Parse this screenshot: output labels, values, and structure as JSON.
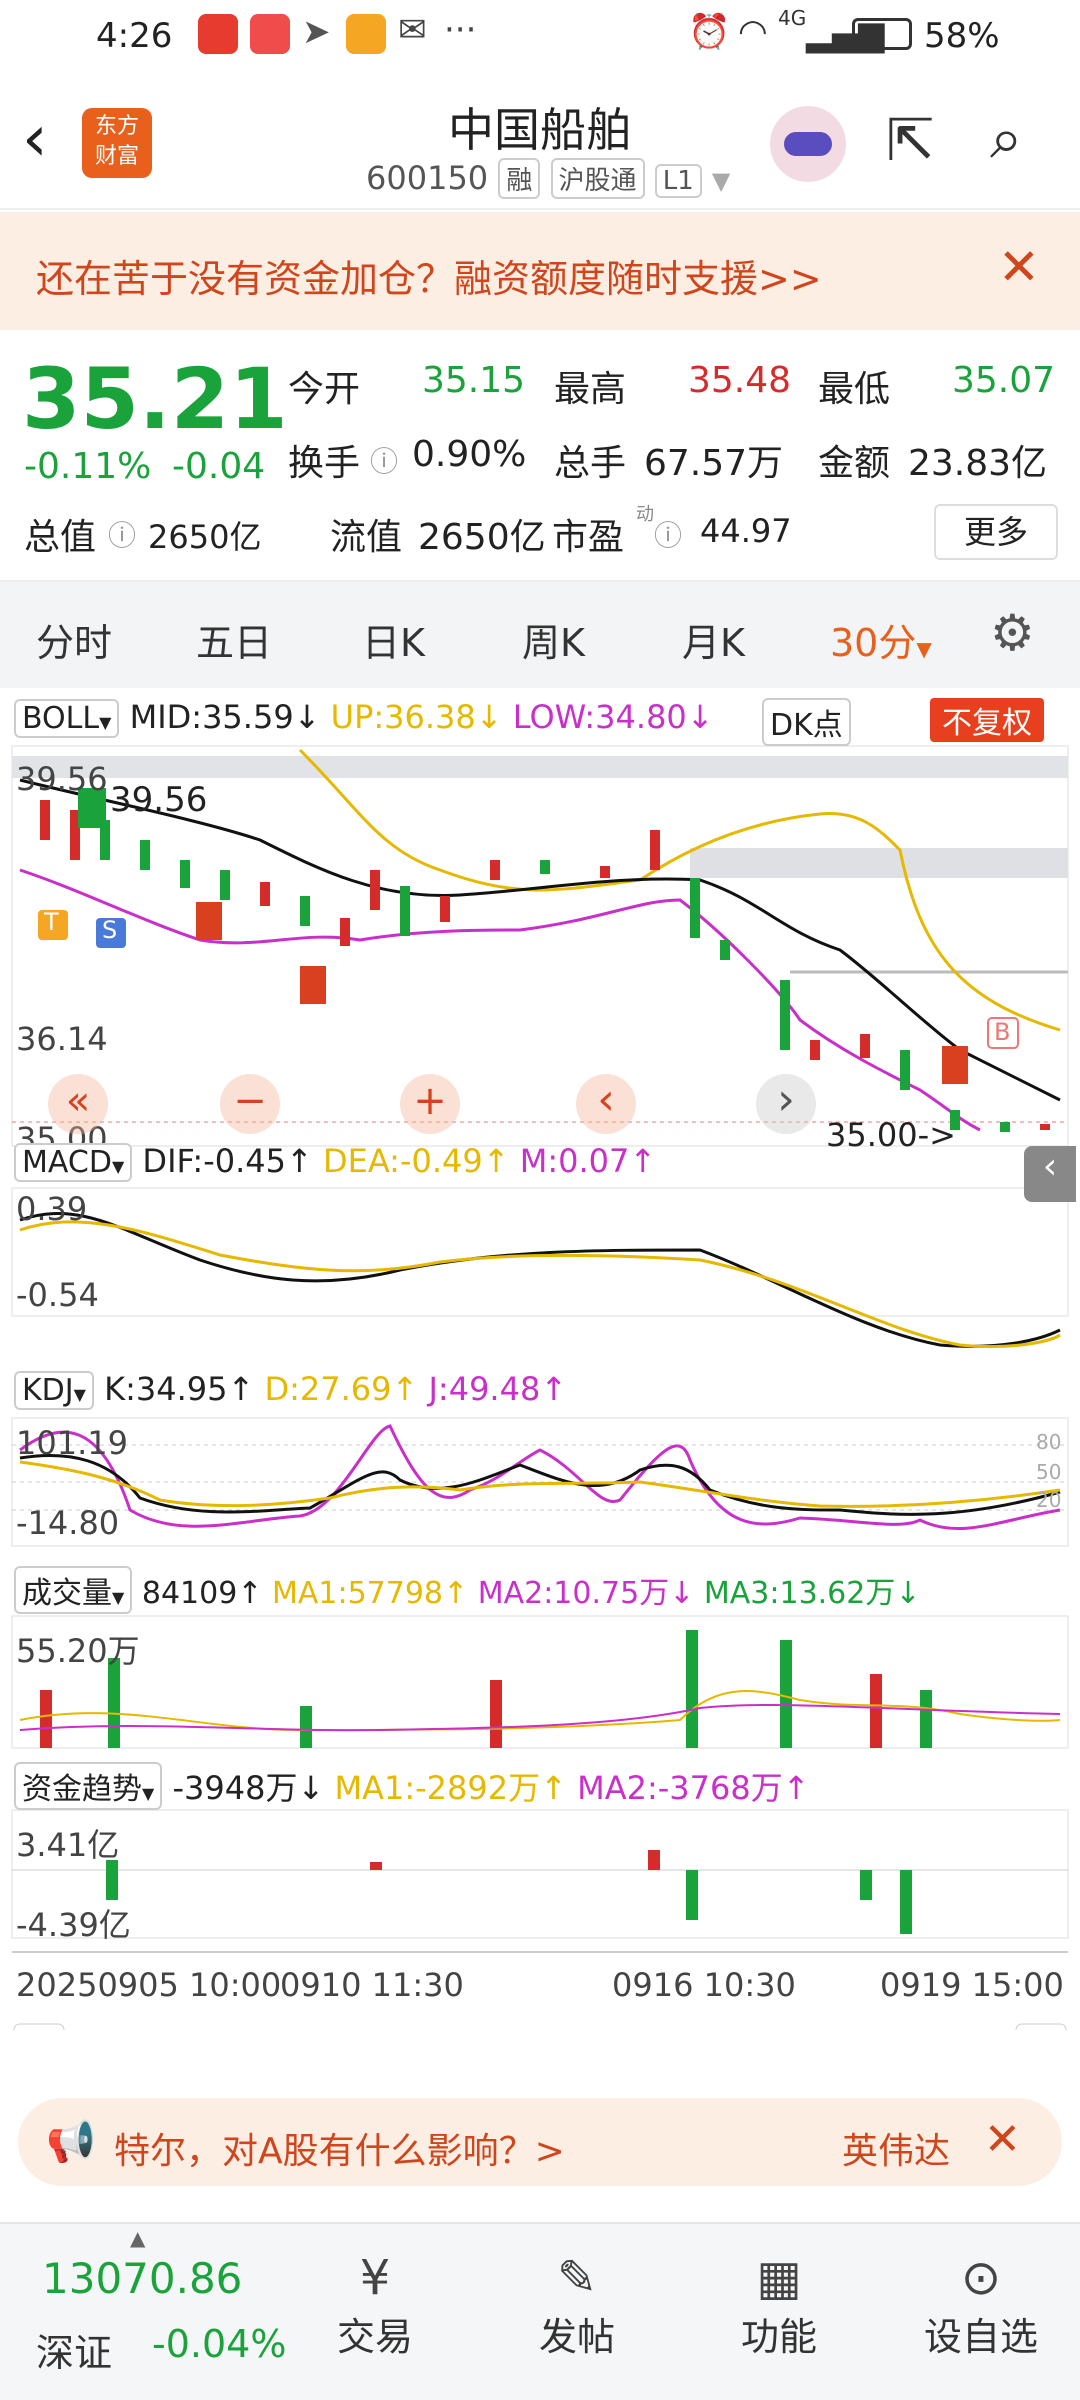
{
  "status": {
    "time": "4:26",
    "battery": "58%",
    "network": "4G"
  },
  "header": {
    "title": "中国船舶",
    "code": "600150",
    "tags": [
      "融",
      "沪股通",
      "L1"
    ],
    "logo_top": "东方",
    "logo_bottom": "财富"
  },
  "banner": {
    "text": "还在苦于没有资金加仓？融资额度随时支援>>"
  },
  "quote": {
    "price": "35.21",
    "change_pct": "-0.11%",
    "change": "-0.04",
    "open_label": "今开",
    "open": "35.15",
    "high_label": "最高",
    "high": "35.48",
    "low_label": "最低",
    "low": "35.07",
    "turnover_label": "换手",
    "turnover": "0.90%",
    "volume_label": "总手",
    "volume": "67.57万",
    "amount_label": "金额",
    "amount": "23.83亿",
    "mcap_label": "总值",
    "mcap": "2650亿",
    "float_label": "流值",
    "float": "2650亿",
    "pe_label": "市盈",
    "pe_sup": "动",
    "pe": "44.97",
    "more": "更多"
  },
  "tabs": [
    "分时",
    "五日",
    "日K",
    "周K",
    "月K",
    "30分"
  ],
  "boll": {
    "name": "BOLL",
    "mid": "MID:35.59↓",
    "up": "UP:36.38↓",
    "low": "LOW:34.80↓",
    "dk": "DK点",
    "fq": "不复权"
  },
  "main_axis": {
    "top": "39.56",
    "mid": "36.14",
    "bottom": "35.00",
    "ann_top": "39.56",
    "ann_bottom": "35.00->",
    "s_label": "S",
    "t_label": "T",
    "b_label": "B"
  },
  "macd": {
    "name": "MACD",
    "dif": "DIF:-0.45↑",
    "dea": "DEA:-0.49↑",
    "m": "M:0.07↑",
    "ytop": "0.39",
    "ybot": "-0.54"
  },
  "kdj": {
    "name": "KDJ",
    "k": "K:34.95↑",
    "d": "D:27.69↑",
    "j": "J:49.48↑",
    "ytop": "101.19",
    "ybot": "-14.80",
    "r80": "80",
    "r50": "50",
    "r20": "20"
  },
  "vol": {
    "name": "成交量",
    "v": "84109↑",
    "ma1": "MA1:57798↑",
    "ma2": "MA2:10.75万↓",
    "ma3": "MA3:13.62万↓",
    "ytop": "55.20万"
  },
  "fund": {
    "name": "资金趋势",
    "v": "-3948万↓",
    "ma1": "MA1:-2892万↑",
    "ma2": "MA2:-3768万↑",
    "ytop": "3.41亿",
    "ybot": "-4.39亿"
  },
  "time_axis": {
    "t1": "20250905 10:00",
    "t2": "0910 11:30",
    "t3": "0916 10:30",
    "t4": "0919 15:00"
  },
  "chart_controls": {
    "first": "«",
    "zoom_out": "−",
    "zoom_in": "+",
    "prev": "‹",
    "next": "›"
  },
  "bottom_banner": {
    "text": "特尔，对A股有什么影响？>",
    "tag": "英伟达"
  },
  "bottom": {
    "index_value": "13070.86",
    "index_name": "深证",
    "index_change": "-0.04%",
    "nav": [
      "交易",
      "发帖",
      "功能",
      "设自选"
    ]
  },
  "colors": {
    "up": "#d62b2b",
    "down": "#1aa33a",
    "accent": "#e8601c"
  },
  "chart_data": {
    "type": "candlestick",
    "series": [
      {
        "name": "MID",
        "value": 35.59
      },
      {
        "name": "UP",
        "value": 36.38
      },
      {
        "name": "LOW",
        "value": 34.8
      }
    ],
    "ylim": [
      35.0,
      39.56
    ]
  }
}
